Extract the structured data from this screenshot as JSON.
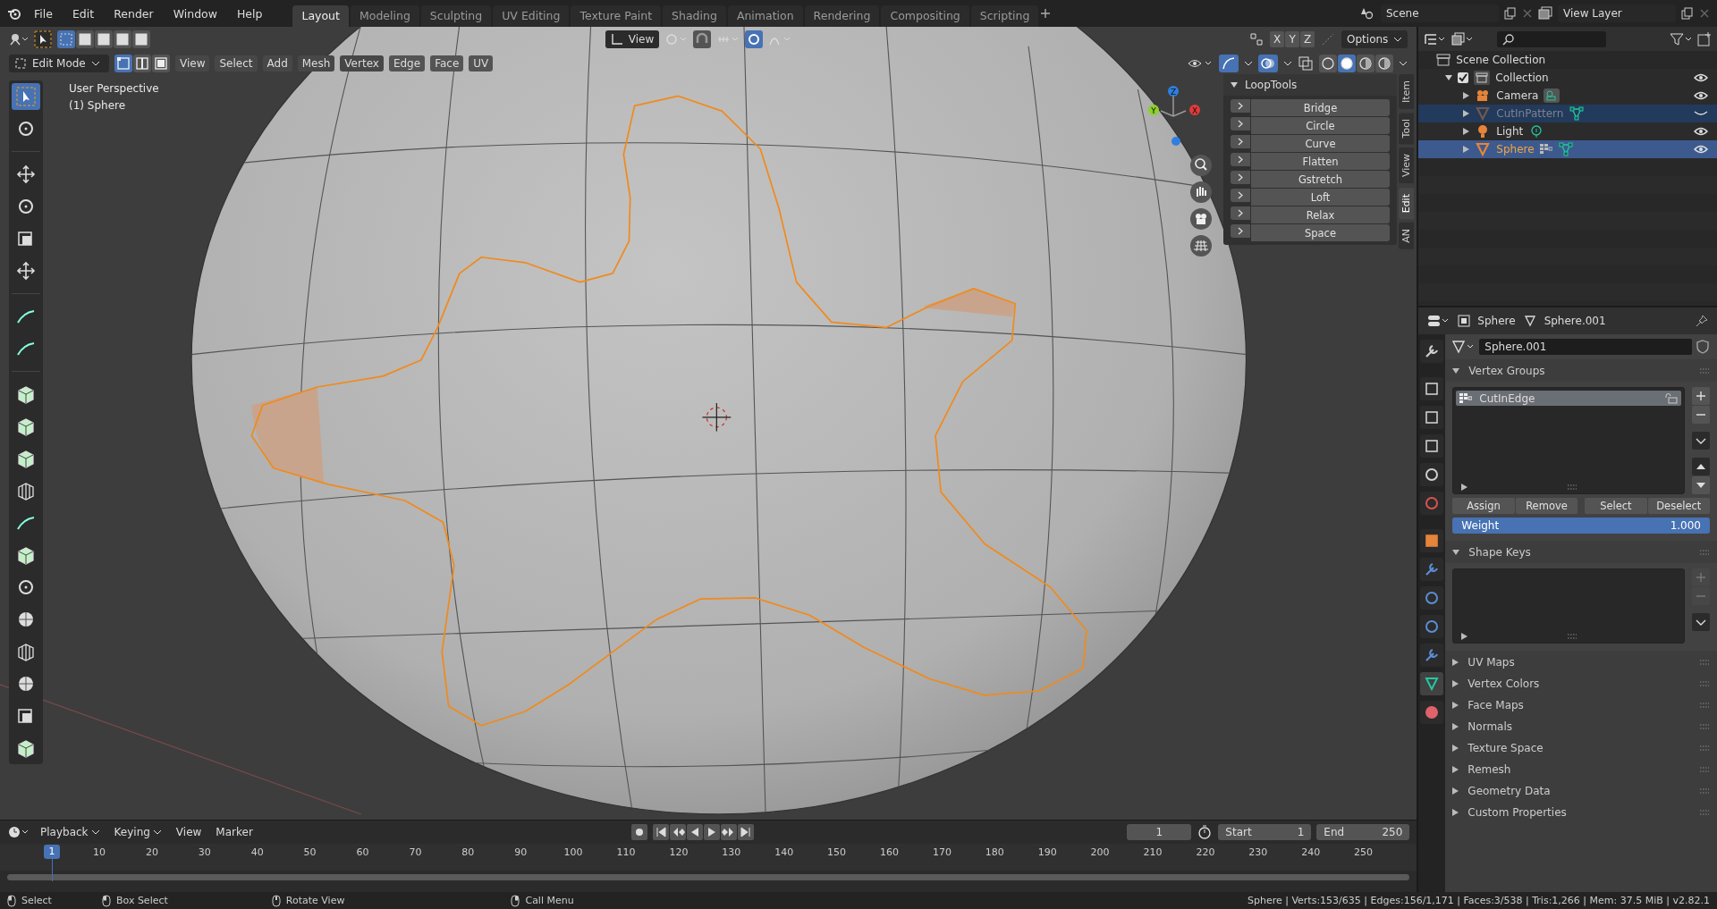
{
  "topbar": {
    "menus": [
      "File",
      "Edit",
      "Render",
      "Window",
      "Help"
    ],
    "workspaces": [
      {
        "label": "Layout",
        "selected": true
      },
      {
        "label": "Modeling",
        "selected": false
      },
      {
        "label": "Sculpting",
        "selected": false
      },
      {
        "label": "UV Editing",
        "selected": false
      },
      {
        "label": "Texture Paint",
        "selected": false
      },
      {
        "label": "Shading",
        "selected": false
      },
      {
        "label": "Animation",
        "selected": false
      },
      {
        "label": "Rendering",
        "selected": false
      },
      {
        "label": "Compositing",
        "selected": false
      },
      {
        "label": "Scripting",
        "selected": false
      }
    ],
    "scene": "Scene",
    "view_layer": "View Layer"
  },
  "viewport": {
    "mode": "Edit Mode",
    "select_modes": [
      {
        "selected": true
      },
      {
        "selected": false
      },
      {
        "selected": false
      }
    ],
    "menus": [
      "View",
      "Select",
      "Add",
      "Mesh",
      "Vertex",
      "Edge",
      "Face",
      "UV"
    ],
    "orientation": "View",
    "mirror_axes": [
      "X",
      "Y",
      "Z"
    ],
    "options": "Options",
    "shading_modes": [
      {
        "selected": false
      },
      {
        "selected": true
      },
      {
        "selected": false
      },
      {
        "selected": false
      }
    ],
    "info_lines": [
      "User Perspective",
      "(1) Sphere"
    ],
    "tools": [
      {
        "kind": "select",
        "selected": true
      },
      {
        "kind": "cursor",
        "selected": false
      },
      {
        "kind": "move",
        "selected": false
      },
      {
        "kind": "rotate",
        "selected": false
      },
      {
        "kind": "scale",
        "selected": false
      },
      {
        "kind": "transform",
        "selected": false
      },
      {
        "kind": "annotate",
        "selected": false
      },
      {
        "kind": "measure",
        "selected": false
      },
      {
        "kind": "extrude",
        "selected": false
      },
      {
        "kind": "inset",
        "selected": false
      },
      {
        "kind": "bevel",
        "selected": false
      },
      {
        "kind": "loopcut",
        "selected": false
      },
      {
        "kind": "knife",
        "selected": false
      },
      {
        "kind": "polybuild",
        "selected": false
      },
      {
        "kind": "spin",
        "selected": false
      },
      {
        "kind": "smooth",
        "selected": false
      },
      {
        "kind": "edgeslide",
        "selected": false
      },
      {
        "kind": "shrink",
        "selected": false
      },
      {
        "kind": "shear",
        "selected": false
      },
      {
        "kind": "rip",
        "selected": false
      }
    ],
    "loop_tools": {
      "title": "LoopTools",
      "expanded": true,
      "items": [
        "Bridge",
        "Circle",
        "Curve",
        "Flatten",
        "Gstretch",
        "Loft",
        "Relax",
        "Space"
      ]
    },
    "side_tabs": [
      {
        "label": "Item",
        "selected": false
      },
      {
        "label": "Tool",
        "selected": false
      },
      {
        "label": "View",
        "selected": false
      },
      {
        "label": "Edit",
        "selected": true
      },
      {
        "label": "AN",
        "selected": false
      }
    ],
    "gizmo_axes": [
      "Z",
      "Y",
      "X"
    ]
  },
  "outliner": {
    "root": "Scene Collection",
    "collection": {
      "name": "Collection",
      "checked": true,
      "expanded": true,
      "children": [
        {
          "name": "Camera",
          "kind": "camera",
          "selected": false,
          "active": false,
          "hidden": false
        },
        {
          "name": "CutInPattern",
          "kind": "mesh",
          "selected": true,
          "active": false,
          "hidden": true
        },
        {
          "name": "Light",
          "kind": "light",
          "selected": false,
          "active": false,
          "hidden": false
        },
        {
          "name": "Sphere",
          "kind": "mesh",
          "selected": true,
          "active": true,
          "hidden": false
        }
      ]
    }
  },
  "properties": {
    "object": "Sphere",
    "data": "Sphere.001",
    "mesh_name": "Sphere.001",
    "tabs": [
      {
        "kind": "tool",
        "selected": false
      },
      {
        "kind": "render",
        "selected": false
      },
      {
        "kind": "output",
        "selected": false
      },
      {
        "kind": "view_layer",
        "selected": false
      },
      {
        "kind": "scene",
        "selected": false
      },
      {
        "kind": "world",
        "selected": false
      },
      {
        "kind": "object",
        "selected": false
      },
      {
        "kind": "modifiers",
        "selected": false
      },
      {
        "kind": "particles",
        "selected": false
      },
      {
        "kind": "physics",
        "selected": false
      },
      {
        "kind": "constraints",
        "selected": false
      },
      {
        "kind": "data",
        "selected": true
      },
      {
        "kind": "material",
        "selected": false
      }
    ],
    "vertex_groups": {
      "title": "Vertex Groups",
      "expanded": true,
      "groups": [
        {
          "name": "CutInEdge",
          "selected": true
        }
      ],
      "buttons": [
        "Assign",
        "Remove",
        "Select",
        "Deselect"
      ],
      "weight": {
        "label": "Weight",
        "value": "1.000",
        "level": 1
      }
    },
    "shape_keys": {
      "title": "Shape Keys",
      "expanded": true
    },
    "collapsed_panels": [
      "UV Maps",
      "Vertex Colors",
      "Face Maps",
      "Normals",
      "Texture Space",
      "Remesh",
      "Geometry Data",
      "Custom Properties"
    ]
  },
  "timeline": {
    "menus": [
      "Playback",
      "Keying",
      "View",
      "Marker"
    ],
    "current_frame": "1",
    "start_label": "Start",
    "start": "1",
    "end_label": "End",
    "end": "250",
    "frame_marker": "1",
    "ticks": [
      "10",
      "20",
      "30",
      "40",
      "50",
      "60",
      "70",
      "80",
      "90",
      "100",
      "110",
      "120",
      "130",
      "140",
      "150",
      "160",
      "170",
      "180",
      "190",
      "200",
      "210",
      "220",
      "230",
      "240",
      "250"
    ]
  },
  "status_bar": {
    "hints": [
      "Select",
      "Box Select",
      "Rotate View",
      "Call Menu"
    ],
    "stats": "Sphere | Verts:153/635 | Edges:156/1,171 | Faces:3/538 | Tris:1,266 | Mem: 37.5 MiB | v2.82.1"
  }
}
